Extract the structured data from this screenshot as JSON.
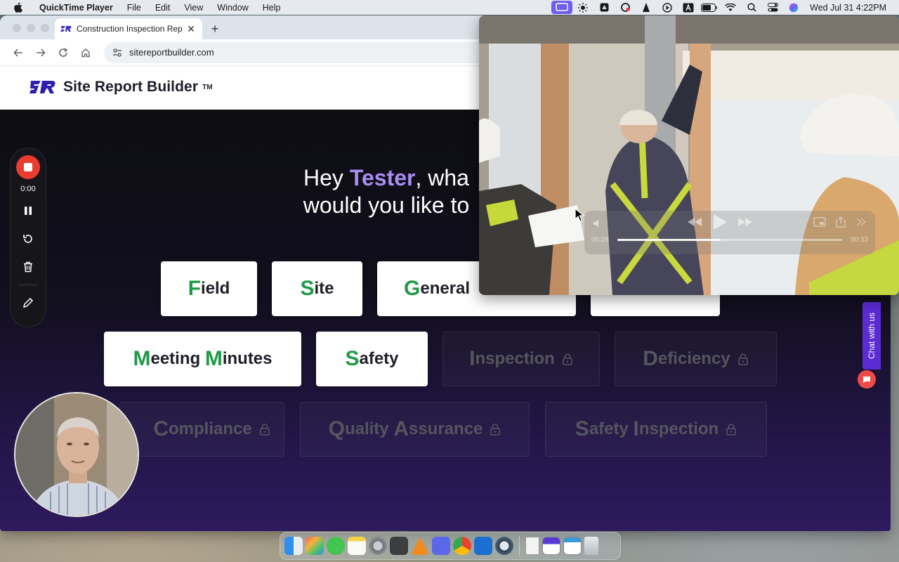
{
  "menubar": {
    "app_name": "QuickTime Player",
    "menus": [
      "File",
      "Edit",
      "View",
      "Window",
      "Help"
    ],
    "clock": "Wed Jul 31  4:22PM"
  },
  "browser": {
    "tab_title": "Construction Inspection Repo",
    "url": "sitereportbuilder.com"
  },
  "site": {
    "logo_text": "Site Report Builder",
    "trademark": "TM",
    "greeting_hey": "Hey",
    "user_name": "Tester",
    "greeting_rest1": ", wha",
    "greeting_line2": "would you like to",
    "accent_color": "#a98df2",
    "initial_color": "#1e9a46"
  },
  "report_types": {
    "field": {
      "initial": "F",
      "rest": "ield"
    },
    "site": {
      "initial": "S",
      "rest": "ite"
    },
    "general": {
      "initial": "G",
      "rest": "eneral"
    },
    "meeting": {
      "initial1": "M",
      "rest1": "eeting ",
      "initial2": "M",
      "rest2": "inutes"
    },
    "safety": {
      "initial": "S",
      "rest": "afety"
    },
    "inspection": {
      "initial": "I",
      "rest": "nspection"
    },
    "deficiency": {
      "initial": "D",
      "rest": "eficiency"
    },
    "compliance": {
      "initial": "C",
      "rest": "ompliance"
    },
    "quality": {
      "initial1": "Q",
      "rest1": "uality ",
      "initial2": "A",
      "rest2": "ssurance"
    },
    "safety_inspection": {
      "initial1": "S",
      "rest1": "afety ",
      "initial2": "I",
      "rest2": "nspection"
    }
  },
  "recorder": {
    "time": "0:00"
  },
  "chat": {
    "label": "Chat with us"
  },
  "quicktime": {
    "elapsed": "00:28",
    "remaining": "00:33",
    "progress": 0.46
  }
}
